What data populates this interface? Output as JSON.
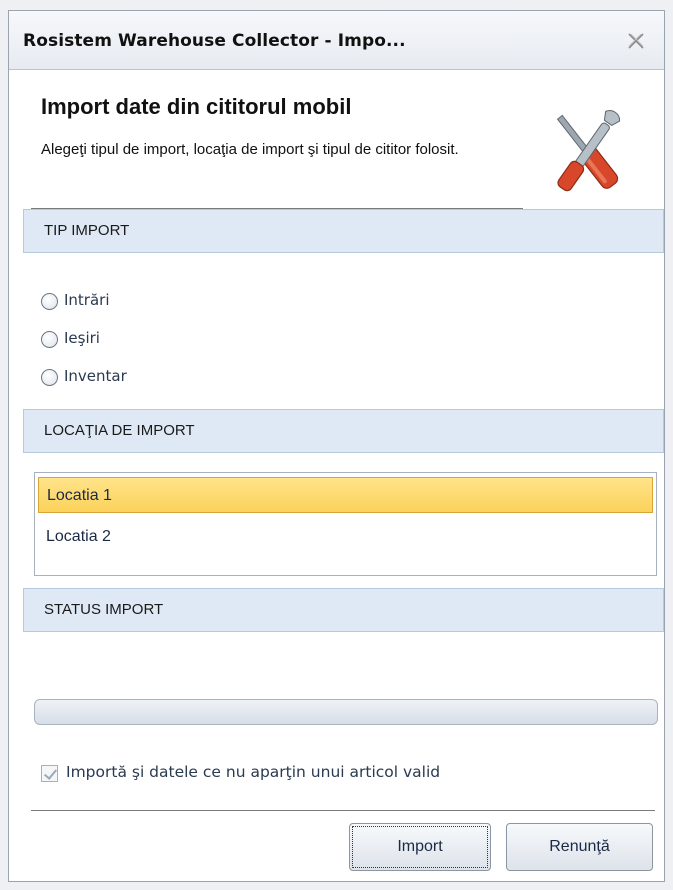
{
  "window": {
    "title": "Rosistem Warehouse Collector - Impo...",
    "close_icon": "close-icon"
  },
  "header": {
    "title": "Import date din cititorul mobil",
    "description": "Alegeţi tipul de import, locaţia de import şi tipul de cititor folosit.",
    "icon": "tools-icon"
  },
  "tip_import": {
    "header": "TIP IMPORT",
    "options": [
      {
        "label": "Intrări",
        "selected": false
      },
      {
        "label": "Ieşiri",
        "selected": false
      },
      {
        "label": "Inventar",
        "selected": false
      }
    ]
  },
  "locatia": {
    "header": "LOCAŢIA DE IMPORT",
    "items": [
      {
        "label": "Locatia 1",
        "selected": true
      },
      {
        "label": "Locatia 2",
        "selected": false
      }
    ]
  },
  "status": {
    "header": "STATUS IMPORT",
    "progress": 0
  },
  "checkbox": {
    "label": "Importă şi datele ce nu aparţin unui articol valid",
    "checked": true,
    "enabled": false
  },
  "buttons": {
    "import": "Import",
    "cancel": "Renunţă"
  },
  "colors": {
    "section_bg": "#dfe9f5",
    "selection": "#fbd25a"
  }
}
